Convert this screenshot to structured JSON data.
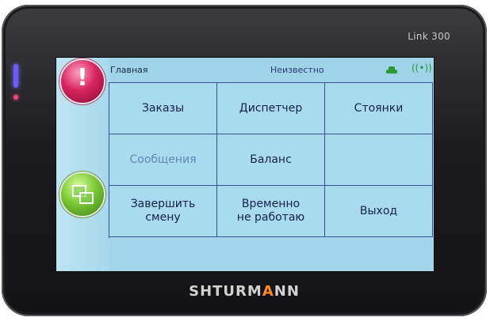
{
  "device": {
    "model": "Link 300",
    "brand_left": "SHTURM",
    "brand_accent": "A",
    "brand_right": "NN"
  },
  "status_bar": {
    "title": "Главная",
    "state": "Неизвестно",
    "car_icon": "taxi-car-icon",
    "signal_icon": "antenna-signal-icon"
  },
  "sidebar": {
    "alert_icon": "exclamation-icon",
    "alert_mark": "!",
    "windows_icon": "windows-icon"
  },
  "menu": {
    "orders": "Заказы",
    "dispatcher": "Диспетчер",
    "stands": "Стоянки",
    "messages": "Сообщения",
    "balance": "Баланс",
    "end_shift_line1": "Завершить",
    "end_shift_line2": "смену",
    "temp_off_line1": "Временно",
    "temp_off_line2": "не работаю",
    "exit": "Выход"
  },
  "colors": {
    "screen_bg": "#9fd3e8",
    "grid_line": "#3a4f9a",
    "accent_orange": "#ff8a1a",
    "alert_pink": "#d7245f",
    "ok_green": "#7ac934"
  }
}
